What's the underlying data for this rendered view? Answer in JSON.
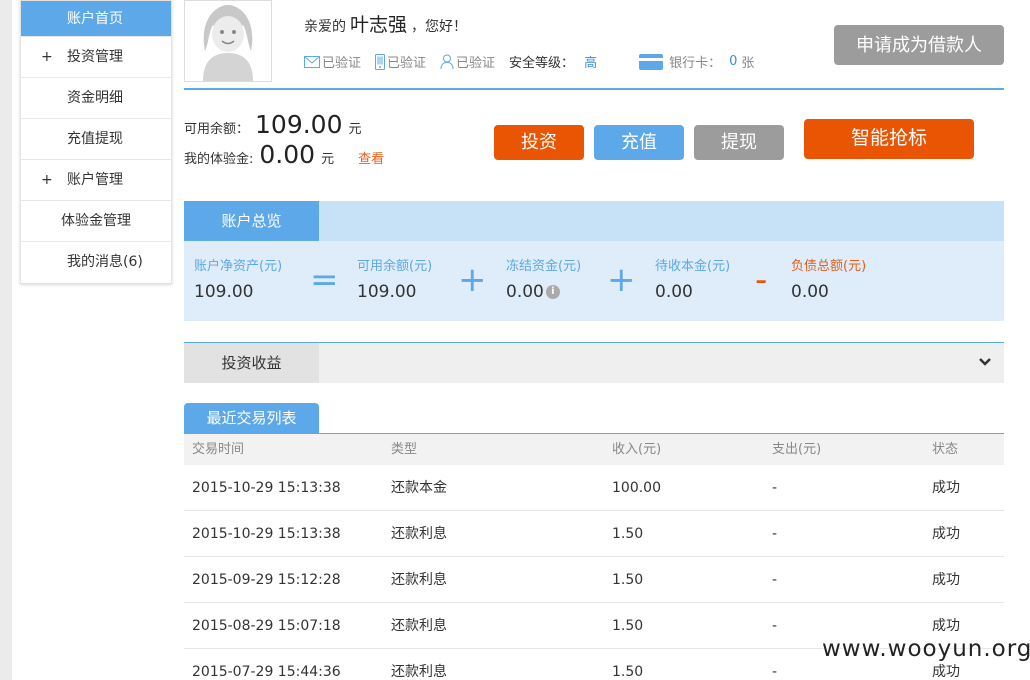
{
  "sidebar": {
    "items": [
      {
        "label": "账户首页",
        "plus": "",
        "active": true
      },
      {
        "label": "投资管理",
        "plus": "+",
        "active": false
      },
      {
        "label": "资金明细",
        "plus": "",
        "active": false
      },
      {
        "label": "充值提现",
        "plus": "",
        "active": false
      },
      {
        "label": "账户管理",
        "plus": "+",
        "active": false
      },
      {
        "label": "体验金管理",
        "plus": "",
        "active": false
      },
      {
        "label": "我的消息(6)",
        "plus": "",
        "active": false
      }
    ]
  },
  "user": {
    "greeting_prefix": "亲爱的",
    "name": "叶志强",
    "greeting_suffix": "，您好！",
    "email_verified": "已验证",
    "phone_verified": "已验证",
    "id_verified": "已验证",
    "security_label": "安全等级：",
    "security_level": "高",
    "bank_label": "银行卡：",
    "bank_count": "0",
    "bank_unit": "张",
    "borrow_button": "申请成为借款人"
  },
  "balance": {
    "available_label": "可用余额：",
    "available_value": "109.00",
    "available_unit": "元",
    "trial_label": "我的体验金:",
    "trial_value": "0.00",
    "trial_unit": "元",
    "view_link": "查看"
  },
  "actions": {
    "invest": "投资",
    "recharge": "充值",
    "withdraw": "提现",
    "smart": "智能抢标"
  },
  "overview": {
    "tab": "账户总览",
    "net_label": "账户净资产(元)",
    "net_value": "109.00",
    "avail_label": "可用余额(元)",
    "avail_value": "109.00",
    "frozen_label": "冻结资金(元)",
    "frozen_value": "0.00",
    "pending_label": "待收本金(元)",
    "pending_value": "0.00",
    "debt_label": "负债总额(元)",
    "debt_value": "0.00",
    "op_eq": "=",
    "op_plus": "+",
    "op_minus": "-",
    "info": "i"
  },
  "earnings": {
    "tab": "投资收益"
  },
  "transactions": {
    "tab": "最近交易列表",
    "headers": [
      "交易时间",
      "类型",
      "收入(元)",
      "支出(元)",
      "状态"
    ],
    "rows": [
      [
        "2015-10-29 15:13:38",
        "还款本金",
        "100.00",
        "-",
        "成功"
      ],
      [
        "2015-10-29 15:13:38",
        "还款利息",
        "1.50",
        "-",
        "成功"
      ],
      [
        "2015-09-29 15:12:28",
        "还款利息",
        "1.50",
        "-",
        "成功"
      ],
      [
        "2015-08-29 15:07:18",
        "还款利息",
        "1.50",
        "-",
        "成功"
      ],
      [
        "2015-07-29 15:44:36",
        "还款利息",
        "1.50",
        "-",
        "成功"
      ]
    ]
  },
  "watermark": "www.wooyun.org",
  "colors": {
    "accent_blue": "#5da8e8",
    "accent_orange": "#ea5504",
    "gray_button": "#9c9c9c"
  }
}
